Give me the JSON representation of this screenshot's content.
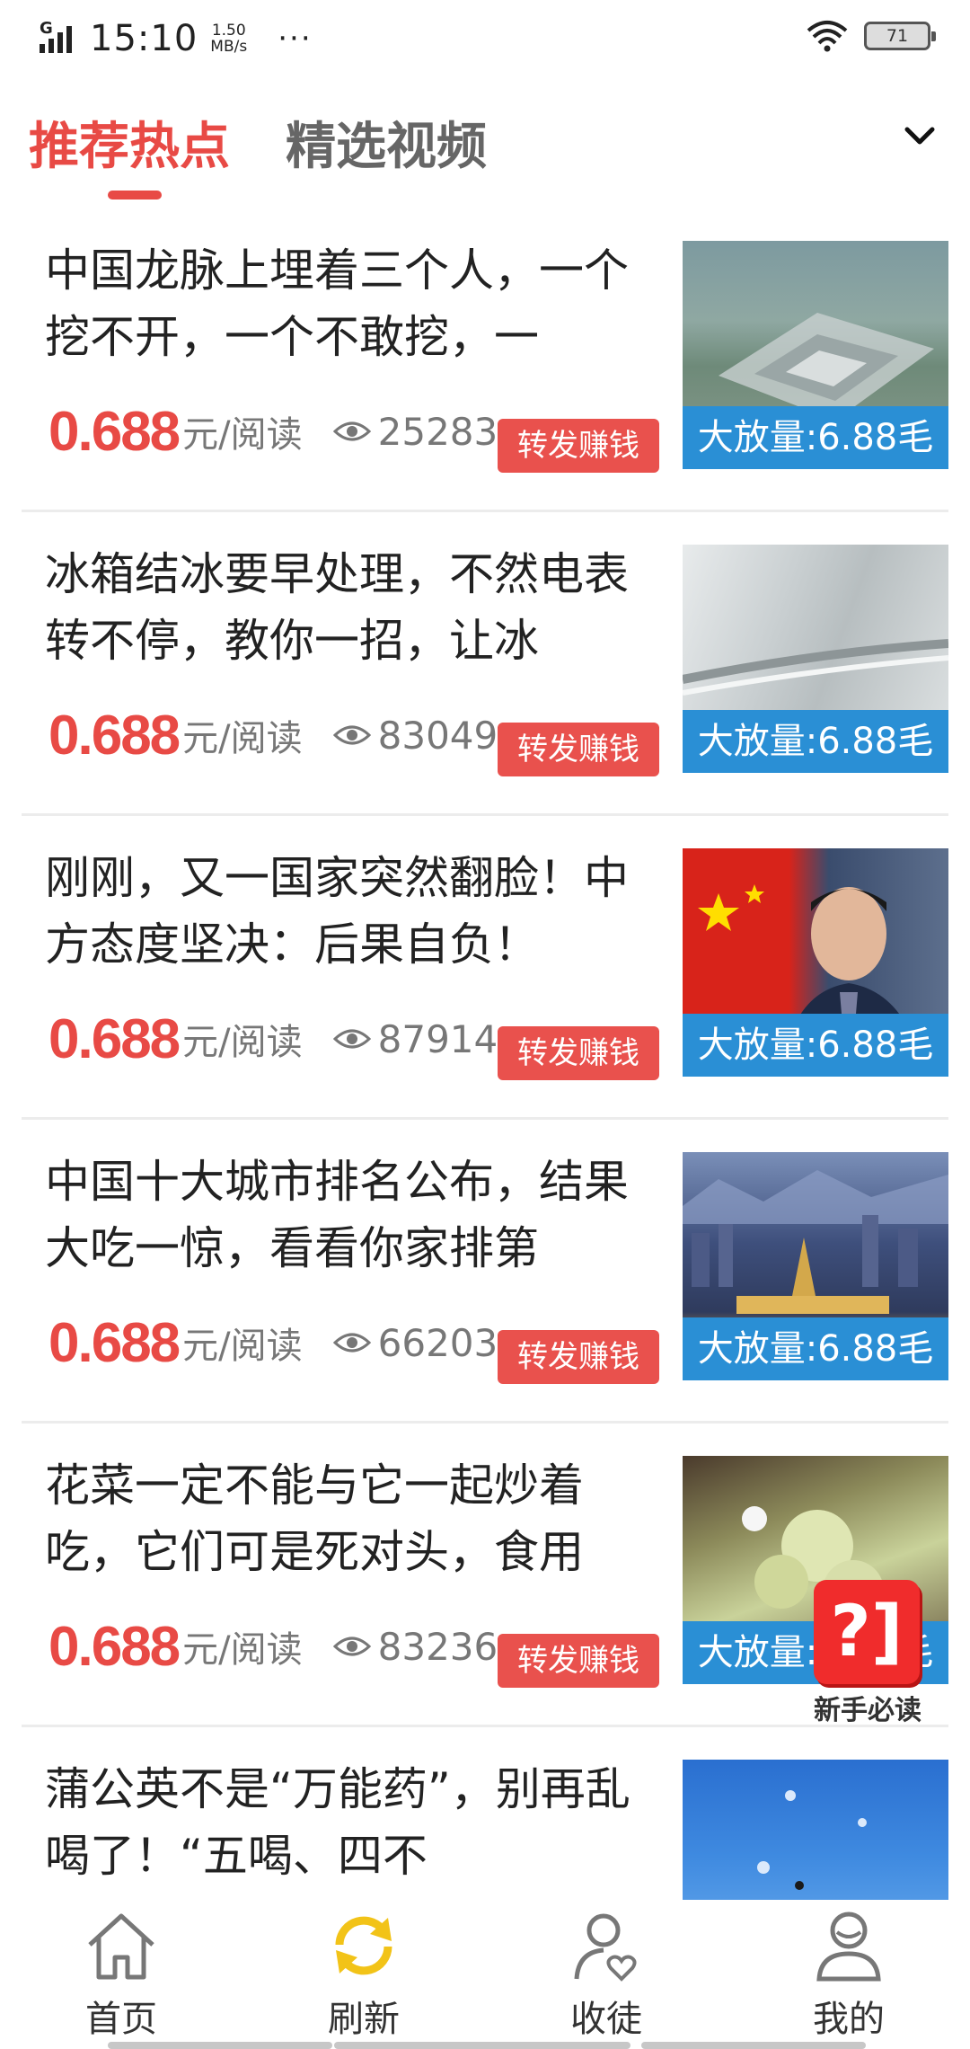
{
  "status_bar": {
    "network_type": "G",
    "time": "15:10",
    "speed_value": "1.50",
    "speed_unit": "MB/s",
    "more": "···",
    "battery": "71"
  },
  "tabs": [
    {
      "label": "推荐热点",
      "active": true
    },
    {
      "label": "精选视频",
      "active": false
    }
  ],
  "articles": [
    {
      "title": "中国龙脉上埋着三个人，一个挖不开，一个不敢挖，一",
      "price": "0.688",
      "unit": "元/阅读",
      "views": "25283",
      "share_label": "转发赚钱",
      "badge": "大放量:6.88毛"
    },
    {
      "title": "冰箱结冰要早处理，不然电表转不停，教你一招，让冰",
      "price": "0.688",
      "unit": "元/阅读",
      "views": "83049",
      "share_label": "转发赚钱",
      "badge": "大放量:6.88毛"
    },
    {
      "title": "刚刚，又一国家突然翻脸！中方态度坚决：后果自负！",
      "price": "0.688",
      "unit": "元/阅读",
      "views": "87914",
      "share_label": "转发赚钱",
      "badge": "大放量:6.88毛"
    },
    {
      "title": "中国十大城市排名公布，结果大吃一惊，看看你家排第",
      "price": "0.688",
      "unit": "元/阅读",
      "views": "66203",
      "share_label": "转发赚钱",
      "badge": "大放量:6.88毛"
    },
    {
      "title": "花菜一定不能与它一起炒着吃，它们可是死对头，食用",
      "price": "0.688",
      "unit": "元/阅读",
      "views": "83236",
      "share_label": "转发赚钱",
      "badge": "大放量:6.88毛"
    },
    {
      "title": "蒲公英不是“万能药”，别再乱喝了！“五喝、四不"
    }
  ],
  "help": {
    "icon_text": "?]",
    "label": "新手必读"
  },
  "bottom_nav": [
    {
      "label": "首页",
      "icon": "home-icon"
    },
    {
      "label": "刷新",
      "icon": "refresh-icon"
    },
    {
      "label": "收徒",
      "icon": "recruit-icon"
    },
    {
      "label": "我的",
      "icon": "profile-icon"
    }
  ],
  "colors": {
    "accent": "#e84a45",
    "badge": "#2a8fd5",
    "refresh": "#f2c318"
  }
}
